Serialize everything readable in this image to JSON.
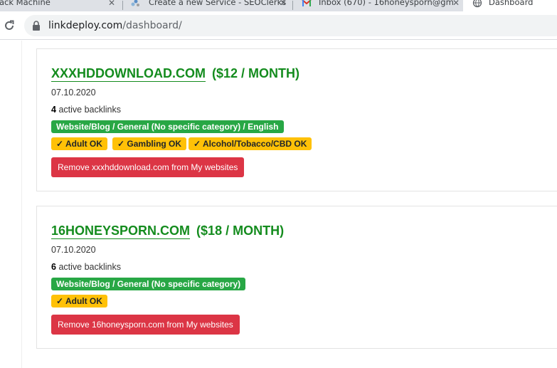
{
  "browser": {
    "tabs": [
      {
        "title": "ack Machine",
        "active": false
      },
      {
        "title": "Create a new Service - SEOClerks",
        "active": false
      },
      {
        "title": "Inbox (670) - 16honeysporn@gm",
        "active": false
      },
      {
        "title": "Dashboard",
        "active": true
      }
    ],
    "close_glyph": "✕",
    "url_host": "linkdeploy.com",
    "url_path": "/dashboard/"
  },
  "websites": [
    {
      "domain": "XXXHDDOWNLOAD.COM",
      "price": "($12 / MONTH)",
      "date": "07.10.2020",
      "backlinks_count": "4",
      "backlinks_label": "active backlinks",
      "category": "Website/Blog / General (No specific category) / English",
      "flags": [
        "✓ Adult OK",
        "✓ Gambling OK",
        "✓ Alcohol/Tobacco/CBD OK"
      ],
      "remove_label": "Remove xxxhddownload.com from My websites"
    },
    {
      "domain": "16HONEYSPORN.COM",
      "price": "($18 / MONTH)",
      "date": "07.10.2020",
      "backlinks_count": "6",
      "backlinks_label": "active backlinks",
      "category": "Website/Blog / General (No specific category)",
      "flags": [
        "✓ Adult OK"
      ],
      "remove_label": "Remove 16honeysporn.com from My websites"
    }
  ],
  "colors": {
    "title_green": "#148c1e",
    "badge_green": "#28a745",
    "badge_yellow": "#ffc107",
    "button_red": "#dc3545"
  },
  "icons": {
    "reload": "reload-icon",
    "lock": "lock-icon",
    "tab_close": "close-icon",
    "seoclerks_favicon": "seoclerks-favicon-icon",
    "gmail_favicon": "gmail-favicon-icon",
    "globe_favicon": "globe-icon"
  }
}
